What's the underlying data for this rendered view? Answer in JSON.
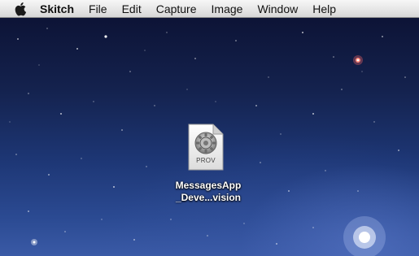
{
  "menubar": {
    "apple_icon": "apple-logo-icon",
    "app_name": "Skitch",
    "items": [
      "File",
      "Edit",
      "Capture",
      "Image",
      "Window",
      "Help"
    ]
  },
  "desktop": {
    "file": {
      "icon": "provisioning-profile-icon",
      "badge": "PROV",
      "name_line1": "MessagesApp",
      "name_line2": "_Deve...vision"
    }
  }
}
